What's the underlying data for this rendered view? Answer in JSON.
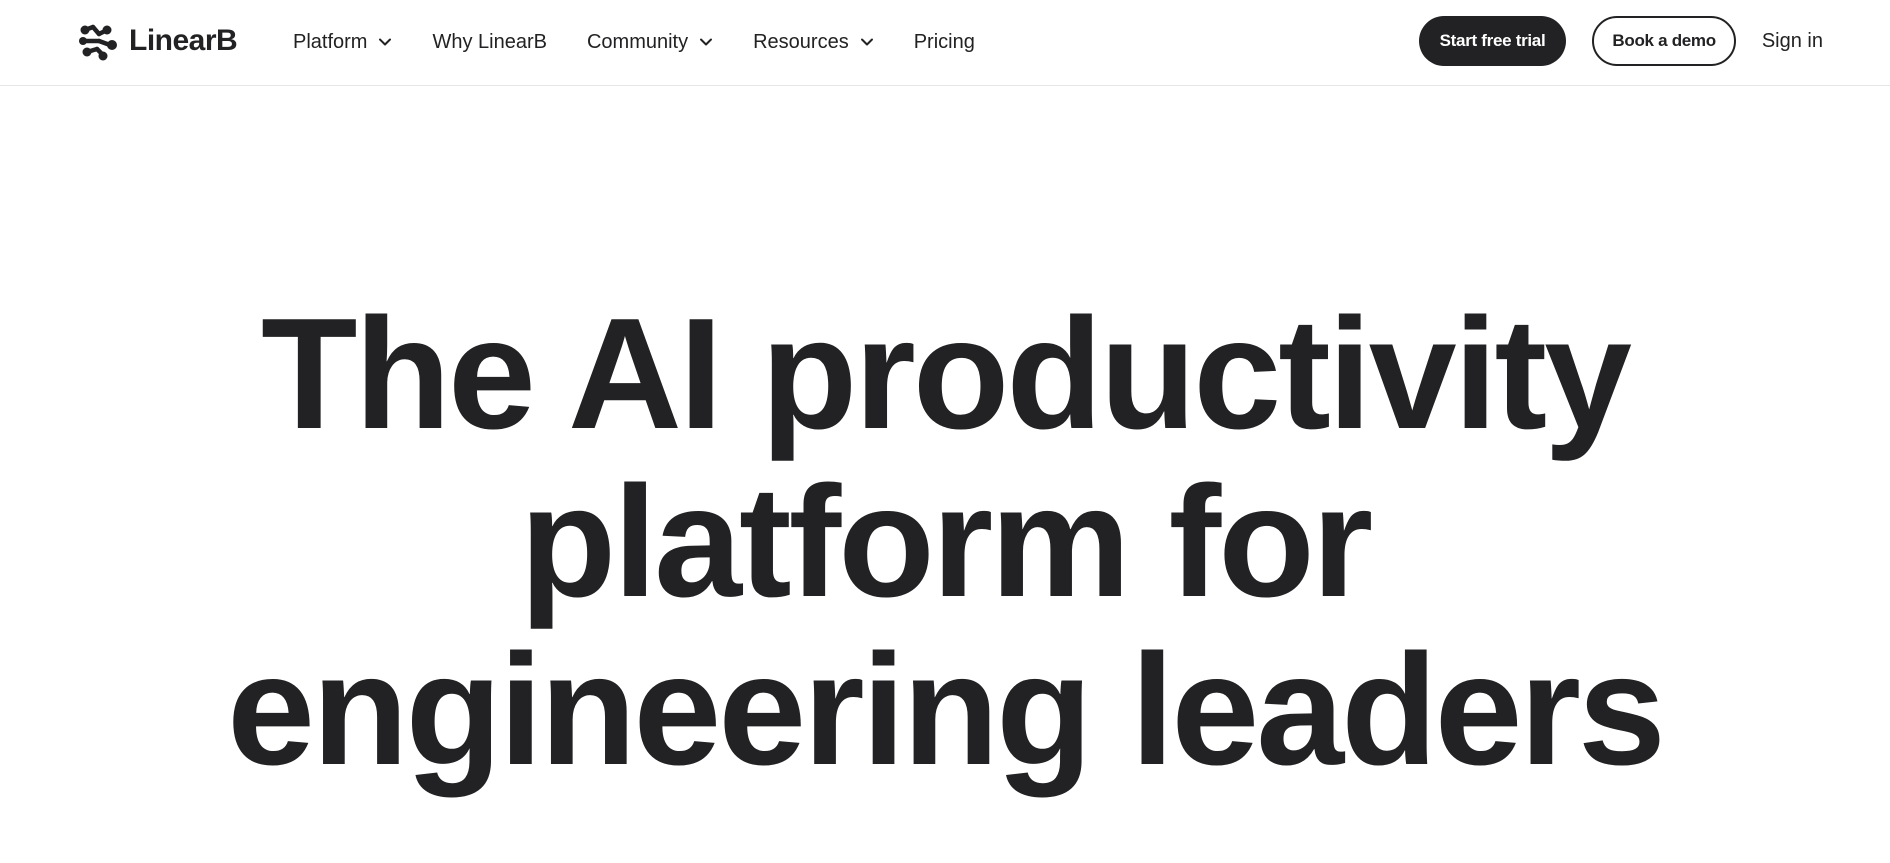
{
  "brand": {
    "name": "LinearB",
    "logo_icon": "linearb-molecule-logo-icon"
  },
  "nav": {
    "items": [
      {
        "label": "Platform",
        "has_dropdown": true
      },
      {
        "label": "Why LinearB",
        "has_dropdown": false
      },
      {
        "label": "Community",
        "has_dropdown": true
      },
      {
        "label": "Resources",
        "has_dropdown": true
      },
      {
        "label": "Pricing",
        "has_dropdown": false
      }
    ],
    "dropdown_icon": "chevron-down-icon"
  },
  "actions": {
    "start_trial_label": "Start free trial",
    "book_demo_label": "Book a demo",
    "sign_in_label": "Sign in"
  },
  "hero": {
    "title_lines": [
      "The AI productivity",
      "platform for",
      "engineering leaders"
    ]
  },
  "colors": {
    "text": "#222224",
    "background": "#ffffff",
    "primary_button_bg": "#222224",
    "primary_button_text": "#ffffff",
    "divider": "#e6e6e6"
  }
}
